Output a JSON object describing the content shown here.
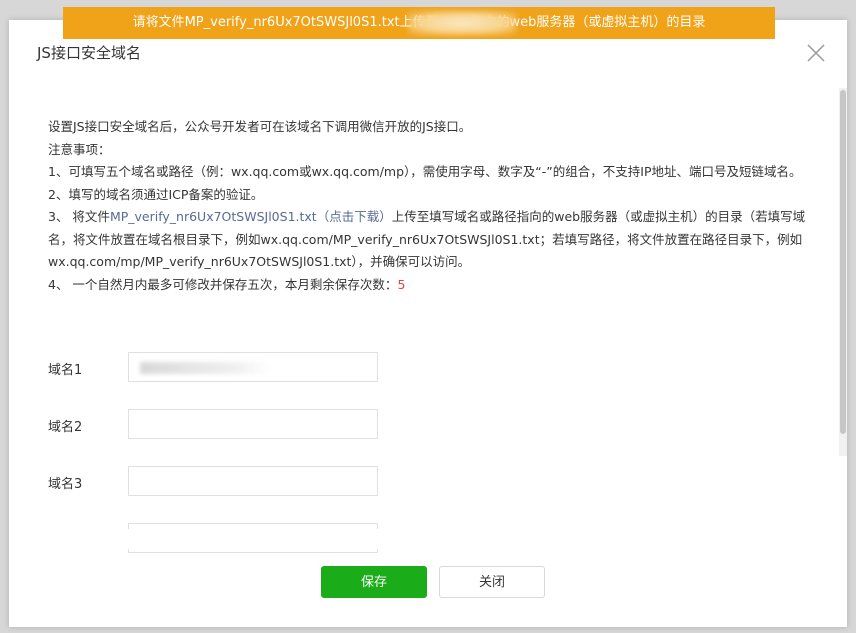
{
  "banner": {
    "text": "请将文件MP_verify_nr6Ux7OtSWSJl0S1.txt上传至              n.cn指向的web服务器（或虚拟主机）的目录"
  },
  "dialog": {
    "title": "JS接口安全域名",
    "close_icon": "close-icon"
  },
  "notice": {
    "intro": "设置JS接口安全域名后，公众号开发者可在该域名下调用微信开放的JS接口。",
    "heading": "注意事项：",
    "item1": "1、可填写五个域名或路径（例：wx.qq.com或wx.qq.com/mp），需使用字母、数字及“-”的组合，不支持IP地址、端口号及短链域名。",
    "item2": "2、填写的域名须通过ICP备案的验证。",
    "item3_prefix": "3、 将文件",
    "item3_file": "MP_verify_nr6Ux7OtSWSJl0S1.txt",
    "item3_download": "（点击下载）",
    "item3_suffix": "上传至填写域名或路径指向的web服务器（或虚拟主机）的目录（若填写域名，将文件放置在域名根目录下，例如wx.qq.com/MP_verify_nr6Ux7OtSWSJl0S1.txt；若填写路径，将文件放置在路径目录下，例如wx.qq.com/mp/MP_verify_nr6Ux7OtSWSJl0S1.txt），并确保可以访问。",
    "item4_prefix": "4、 一个自然月内最多可修改并保存五次，本月剩余保存次数：",
    "item4_count": "5"
  },
  "fields": [
    {
      "label": "域名1",
      "value": ""
    },
    {
      "label": "域名2",
      "value": ""
    },
    {
      "label": "域名3",
      "value": ""
    }
  ],
  "buttons": {
    "save": "保存",
    "close": "关闭"
  },
  "colors": {
    "banner": "#f0a219",
    "primary": "#1aad19",
    "link": "#576b95",
    "count": "#e64340"
  }
}
